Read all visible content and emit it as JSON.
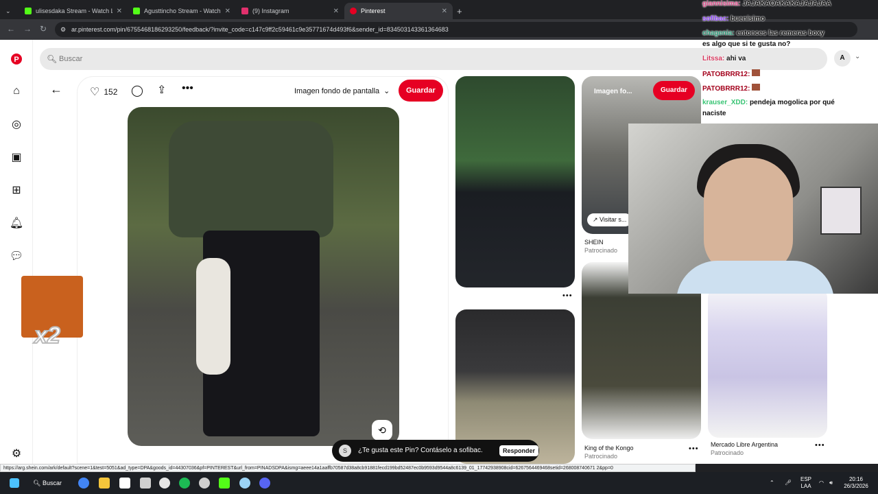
{
  "tabs": [
    {
      "title": "ulisesdaka Stream - Watch Live",
      "icon": "kick-icon",
      "color": "#53fc18"
    },
    {
      "title": "Agusttincho Stream - Watch Live",
      "icon": "kick-icon",
      "color": "#53fc18"
    },
    {
      "title": "(9) Instagram",
      "icon": "instagram-icon",
      "color": "#e1306c"
    },
    {
      "title": "Pinterest",
      "icon": "pinterest-icon",
      "color": "#e60023"
    }
  ],
  "address": {
    "url": "ar.pinterest.com/pin/6755468186293250/feedback/?invite_code=c147c9ff2c59461c9e35771674d493f6&sender_id=834503143361364683"
  },
  "search": {
    "placeholder": "Buscar"
  },
  "profile": {
    "initial": "A"
  },
  "pin": {
    "likes": "152",
    "board_select": "Imagen fondo de pantalla",
    "save_label": "Guardar"
  },
  "grid": {
    "card2": {
      "board": "Imagen fo...",
      "save_label": "Guardar",
      "visit_label": "Visitar s...",
      "title": "SHEIN",
      "subtitle": "Patrocinado"
    },
    "card3": {
      "title": "King of the Kongo",
      "subtitle": "Patrocinado"
    },
    "card4": {
      "title": "Mercado Libre Argentina",
      "subtitle": "Patrocinado"
    }
  },
  "chat": [
    {
      "user": "giannisima:",
      "msg": "JAJAKAOAKAKAJAJAJAA",
      "color": "#e0508e"
    },
    {
      "user": "sofibac:",
      "msg": "buenisimo",
      "color": "#9147ff"
    },
    {
      "user": "chagenia:",
      "msg": "entonces las remeras boxy",
      "color": "#2f9a7a"
    },
    {
      "user": "",
      "msg": "es algo que si te gusta no?",
      "color": "#111"
    },
    {
      "user": "Litssa:",
      "msg": "ahi va",
      "color": "#d6395e"
    },
    {
      "user": "PATOBRRR12:",
      "msg": "",
      "color": "#a3001b"
    },
    {
      "user": "PATOBRRR12:",
      "msg": "",
      "color": "#a3001b"
    },
    {
      "user": "krauser_XDD:",
      "msg": "pendeja mogolica por qué",
      "color": "#39c474"
    },
    {
      "user": "",
      "msg": "naciste",
      "color": "#111"
    }
  ],
  "emote": {
    "multiplier": "x2"
  },
  "toast": {
    "initial": "S",
    "text": "¿Te gusta este Pin? Contáselo a sofibac.",
    "button": "Responder"
  },
  "status_url": "https://arg.shein.com/ark/default?scene=1&test=5051&ad_type=DPA&goods_id=44307036&pf=PINTEREST&url_from=PINADSDPA&ismg=aeee14a1aaffb70587d38a8cb91881fecd199bd52487ec0b9593d9544a8c6139_01_17742938908cid=6267564469468setid=268008740671 2&pp=0",
  "taskbar": {
    "search_label": "Buscar",
    "lang": "ESP",
    "lang2": "LAA",
    "time": "20:16",
    "date": "26/3/2026",
    "apps": [
      {
        "name": "chrome-icon",
        "color": "#4285f4"
      },
      {
        "name": "explorer-icon",
        "color": "#f4c53b"
      },
      {
        "name": "notion-icon",
        "color": "#ffffff"
      },
      {
        "name": "snipping-icon",
        "color": "#d0d0d0"
      },
      {
        "name": "chatgpt-icon",
        "color": "#e6e6e6"
      },
      {
        "name": "spotify-icon",
        "color": "#1db954"
      },
      {
        "name": "obs-icon",
        "color": "#cfcfcf"
      },
      {
        "name": "kick-icon",
        "color": "#53fc18"
      },
      {
        "name": "ccleaner-icon",
        "color": "#9bd3f5"
      },
      {
        "name": "discord-icon",
        "color": "#5865f2"
      }
    ]
  }
}
